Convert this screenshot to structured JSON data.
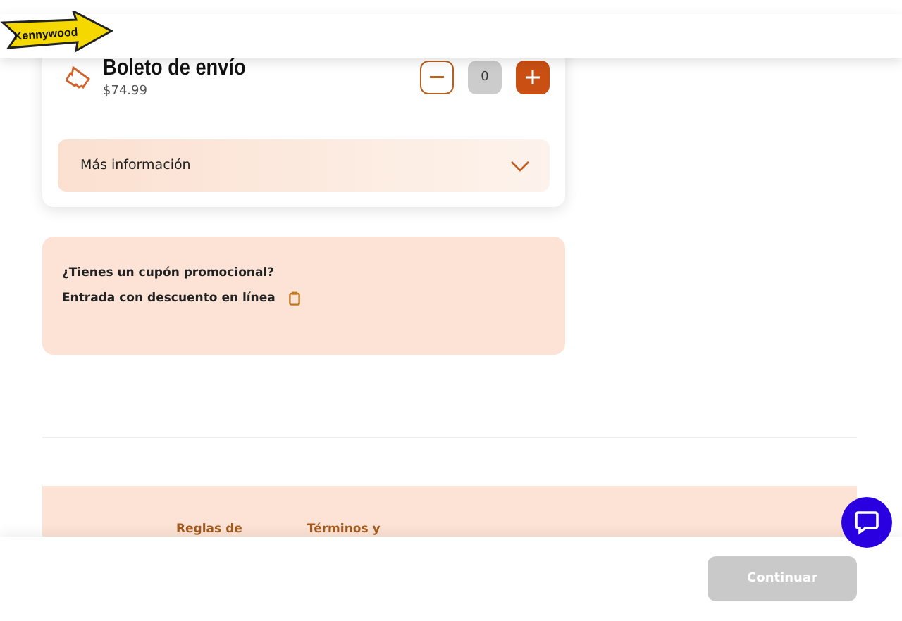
{
  "header": {
    "logo": "Kennywood"
  },
  "product": {
    "title": "Boleto de envío",
    "price": "$74.99",
    "quantity": "0",
    "more_info": {
      "label": "Más información",
      "expanded": false
    }
  },
  "promo": {
    "title": "¿Tienes un cupón promocional?",
    "text": "Entrada con descuento en línea"
  },
  "footer_links": [
    "Reglas de",
    "Términos y"
  ],
  "continue_button": {
    "label": "Continuar",
    "disabled": true
  }
}
